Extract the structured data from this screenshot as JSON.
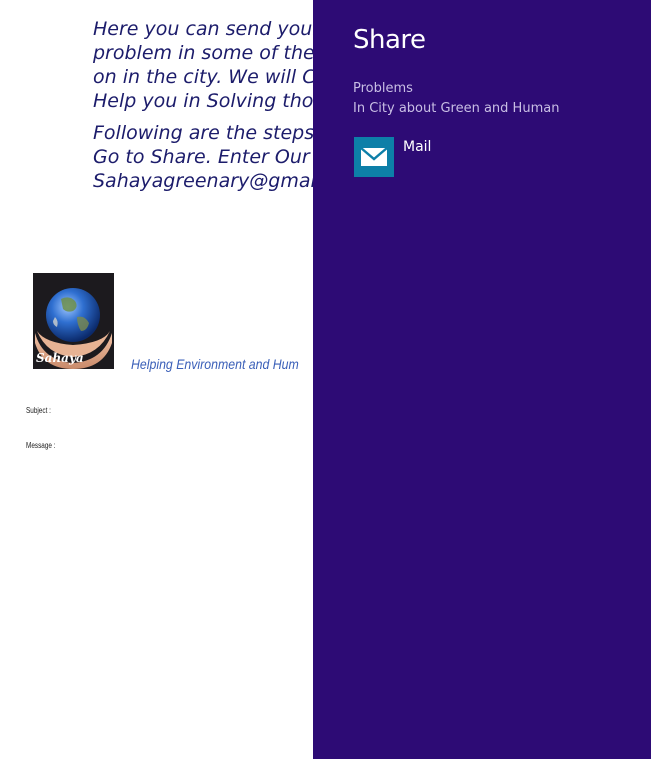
{
  "page": {
    "intro_lines": [
      "Here you can send your fe",
      "problem in some of the gr",
      "on in the city. We will Con",
      "Help you in Solving those"
    ],
    "steps_lines": [
      "Following are the steps to",
      "Go to Share. Enter Our Ma",
      "Sahayagreenary@gmail.c"
    ],
    "logo_text": "Sahaya",
    "tagline": "Helping Environment and Hum",
    "subject_label": "Subject :",
    "message_label": "Message :"
  },
  "share_charm": {
    "title": "Share",
    "desc_line1": "Problems",
    "desc_line2": "In City about Green and Human",
    "targets": [
      {
        "label": "Mail",
        "icon": "mail-icon",
        "tile_color": "#0d7fa8"
      }
    ],
    "background": "#2d0b75"
  }
}
